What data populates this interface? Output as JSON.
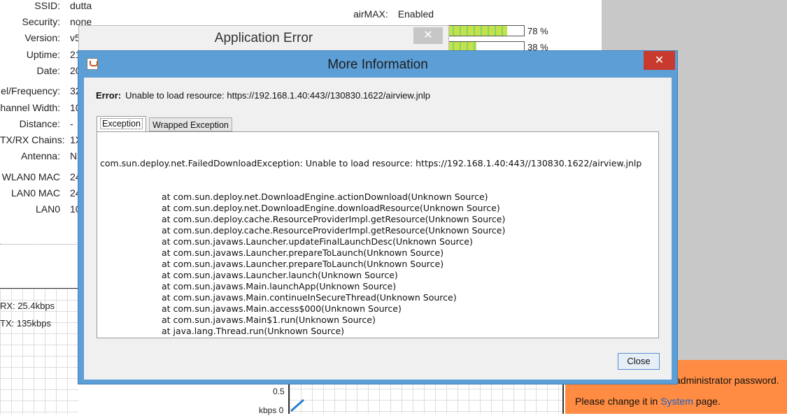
{
  "background": {
    "info_rows": [
      {
        "label": "SSID:",
        "value": "dutta"
      },
      {
        "label": "Security:",
        "value": "none"
      },
      {
        "label": "Version:",
        "value": "v5"
      },
      {
        "label": "Uptime:",
        "value": "21"
      },
      {
        "label": "Date:",
        "value": "20"
      },
      {
        "label": "el/Frequency:",
        "value": "32"
      },
      {
        "label": "hannel Width:",
        "value": "10"
      },
      {
        "label": "Distance:",
        "value": "-"
      },
      {
        "label": "TX/RX Chains:",
        "value": "1X"
      },
      {
        "label": "Antenna:",
        "value": "N("
      },
      {
        "label": "WLAN0 MAC",
        "value": "24"
      },
      {
        "label": "LAN0 MAC",
        "value": "24"
      },
      {
        "label": "LAN0",
        "value": "10"
      }
    ],
    "airmax_label": "airMAX:",
    "airmax_value": "Enabled",
    "bar1_pct": "78 %",
    "bar1_level": 78,
    "bar2_pct": "38 %",
    "bar2_level": 38,
    "rx_text": "RX: 25.4kbps",
    "tx_text": "TX: 135kbps",
    "axis_half": "0.5",
    "axis_zero": "kbps 0",
    "notice_line1": "administrator password.",
    "notice_line2_prefix": "Please change it in ",
    "notice_link": "System",
    "notice_line2_suffix": " page."
  },
  "app_error": {
    "title": "Application Error",
    "close_glyph": "✕"
  },
  "dialog": {
    "title": "More Information",
    "close_glyph": "✕",
    "error_label": "Error:",
    "error_message": "Unable to load resource: https://192.168.1.40:443//130830.1622/airview.jnlp",
    "tabs": [
      "Exception",
      "Wrapped Exception"
    ],
    "trace_first": "com.sun.deploy.net.FailedDownloadException: Unable to load resource: https://192.168.1.40:443//130830.1622/airview.jnlp",
    "trace_frames": [
      "at com.sun.deploy.net.DownloadEngine.actionDownload(Unknown Source)",
      "at com.sun.deploy.net.DownloadEngine.downloadResource(Unknown Source)",
      "at com.sun.deploy.cache.ResourceProviderImpl.getResource(Unknown Source)",
      "at com.sun.deploy.cache.ResourceProviderImpl.getResource(Unknown Source)",
      "at com.sun.javaws.Launcher.updateFinalLaunchDesc(Unknown Source)",
      "at com.sun.javaws.Launcher.prepareToLaunch(Unknown Source)",
      "at com.sun.javaws.Launcher.prepareToLaunch(Unknown Source)",
      "at com.sun.javaws.Launcher.launch(Unknown Source)",
      "at com.sun.javaws.Main.launchApp(Unknown Source)",
      "at com.sun.javaws.Main.continueInSecureThread(Unknown Source)",
      "at com.sun.javaws.Main.access$000(Unknown Source)",
      "at com.sun.javaws.Main$1.run(Unknown Source)",
      "at java.lang.Thread.run(Unknown Source)"
    ],
    "close_button_label": "Close",
    "icon": "java-icon"
  }
}
